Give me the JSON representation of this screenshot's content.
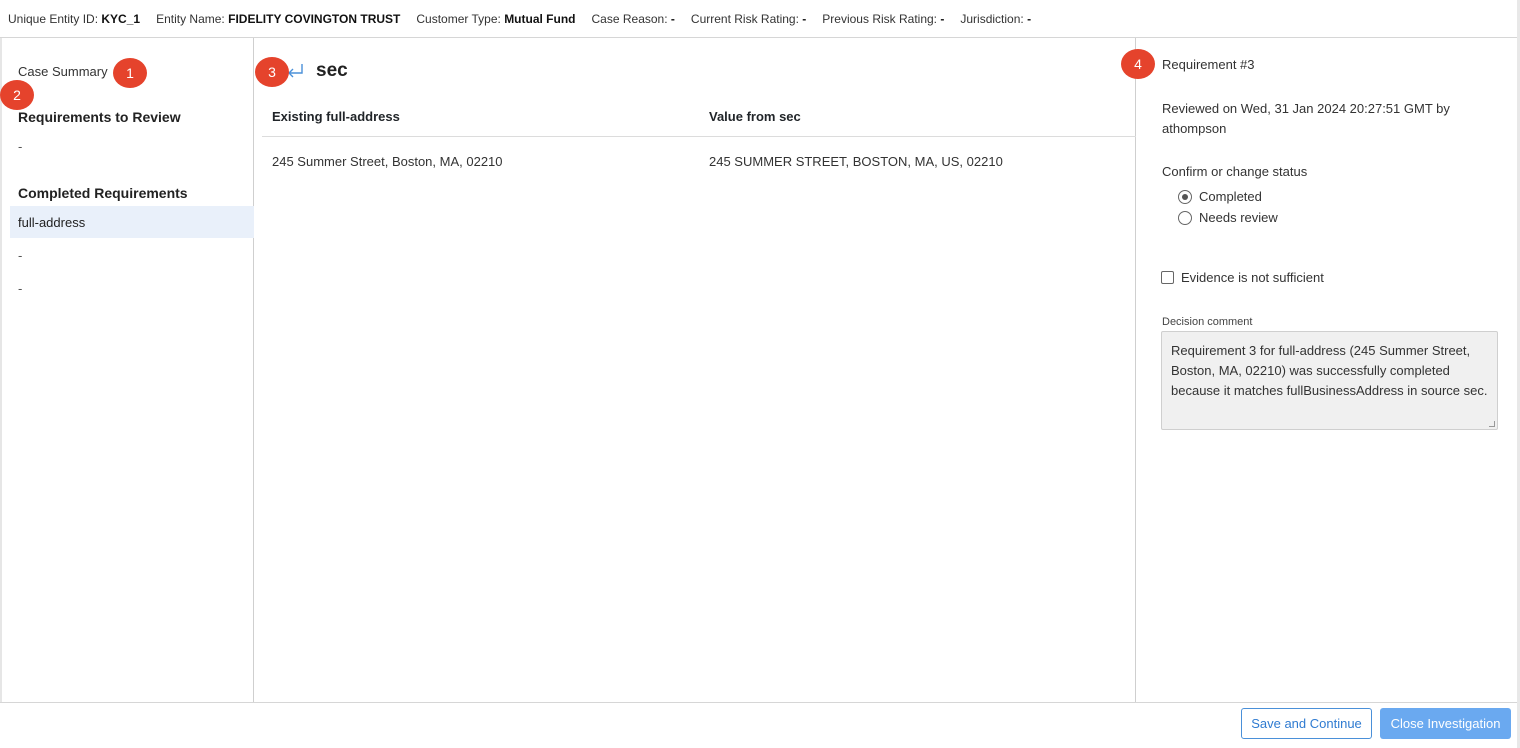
{
  "header": {
    "entity_id_label": "Unique Entity ID:",
    "entity_id": "KYC_1",
    "entity_name_label": "Entity Name:",
    "entity_name": "FIDELITY COVINGTON TRUST",
    "customer_type_label": "Customer Type:",
    "customer_type": "Mutual Fund",
    "case_reason_label": "Case Reason:",
    "case_reason": "-",
    "current_risk_label": "Current Risk Rating:",
    "current_risk": "-",
    "previous_risk_label": "Previous Risk Rating:",
    "previous_risk": "-",
    "jurisdiction_label": "Jurisdiction:",
    "jurisdiction": "-"
  },
  "sidebar": {
    "case_summary": "Case Summary",
    "to_review_heading": "Requirements to Review",
    "to_review_items": [
      "-"
    ],
    "completed_heading": "Completed Requirements",
    "completed_items": [
      "full-address",
      "-",
      "-"
    ]
  },
  "main": {
    "source": "sec",
    "columns": [
      "Existing full-address",
      "Value from sec"
    ],
    "rows": [
      [
        "245 Summer Street, Boston, MA, 02210",
        "245 SUMMER STREET, BOSTON, MA, US, 02210"
      ]
    ]
  },
  "details": {
    "title": "Requirement #3",
    "reviewed": "Reviewed on Wed, 31 Jan 2024 20:27:51 GMT by athompson",
    "confirm_label": "Confirm or change status",
    "status_options": [
      "Completed",
      "Needs review"
    ],
    "selected_status": "Completed",
    "evidence_label": "Evidence is not sufficient",
    "evidence_checked": false,
    "decision_label": "Decision comment",
    "decision_comment": "Requirement 3 for full-address (245 Summer Street, Boston, MA, 02210) was successfully completed because it matches fullBusinessAddress in source sec."
  },
  "footer": {
    "save_label": "Save and Continue",
    "close_label": "Close Investigation"
  },
  "annotations": [
    "1",
    "2",
    "3",
    "4"
  ],
  "colors": {
    "badge": "#e5432c",
    "primary": "#6aa9f0",
    "selected_row": "#e9f0fa"
  }
}
